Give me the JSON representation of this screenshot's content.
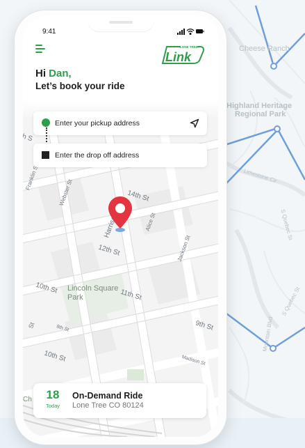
{
  "colors": {
    "brand_green": "#2f9e49",
    "pin_red": "#e4343f",
    "text_dark": "#1d1d1d",
    "route_blue": "#6f9fda"
  },
  "status_bar": {
    "time": "9:41",
    "icons": [
      "signal-icon",
      "wifi-icon",
      "battery-icon"
    ]
  },
  "header": {
    "menu_icon": "hamburger-menu-icon",
    "logo_small_text": "LONE TREE",
    "logo_text": "Link",
    "greeting_prefix": "Hi",
    "greeting_name": "Dan,",
    "subtitle": "Let’s book your ride"
  },
  "address": {
    "pickup_placeholder": "Enter your pickup address",
    "dropoff_placeholder": "Enter the drop off address",
    "locate_icon": "navigation-arrow-icon"
  },
  "map": {
    "streets": [
      "14th St",
      "Harrison St",
      "Alice St",
      "12th St",
      "Jackson St",
      "Webster St",
      "Franklin St",
      "10th St",
      "11th St",
      "9th St",
      "8th St",
      "10th St",
      "Madison St"
    ],
    "park_name": "Lincoln Square Park",
    "chinatown_fragment": "Ch",
    "cut_label_1": "th S",
    "cut_label_2": "St"
  },
  "background_map": {
    "labels": [
      "Cheese Ranch",
      "Highland Heritage",
      "Regional Park",
      "Limestone Cir",
      "S Quebec St",
      "S Quebec St",
      "Mountain Blvd"
    ]
  },
  "ride": {
    "day": "18",
    "day_label": "Today",
    "title": "On-Demand Ride",
    "location": "Lone Tree CO 80124"
  }
}
